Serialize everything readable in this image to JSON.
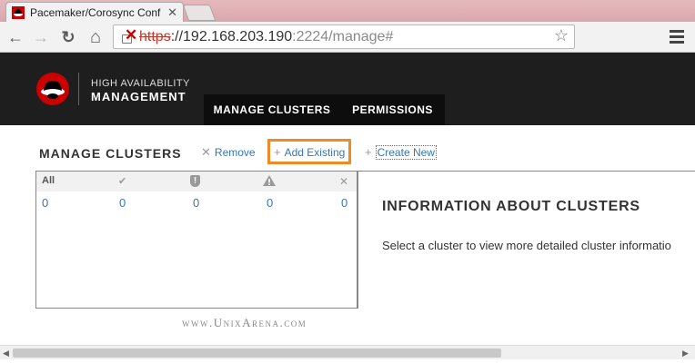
{
  "browser": {
    "tab_title": "Pacemaker/Corosync Conf",
    "tab_close": "✕",
    "url_scheme": "https",
    "url_host": "://192.168.203.190",
    "url_port": ":2224/manage#",
    "nav": {
      "back": "←",
      "forward": "→",
      "reload": "↻",
      "home": "⌂"
    }
  },
  "app": {
    "brand_top": "HIGH AVAILABILITY",
    "brand_main": "MANAGEMENT",
    "nav_tabs": [
      {
        "label": "MANAGE CLUSTERS"
      },
      {
        "label": "PERMISSIONS"
      }
    ]
  },
  "manage": {
    "title": "MANAGE CLUSTERS",
    "actions": {
      "remove": {
        "glyph": "✕",
        "label": "Remove"
      },
      "add_existing": {
        "glyph": "+",
        "label": "Add Existing"
      },
      "create_new": {
        "glyph": "+",
        "label": "Create New"
      }
    },
    "list": {
      "columns": [
        {
          "label": "All",
          "icon": "all-label"
        },
        {
          "label": "✔",
          "icon": "check-icon"
        },
        {
          "label": "!",
          "icon": "shield-alert-icon"
        },
        {
          "label": "!",
          "icon": "warning-icon"
        },
        {
          "label": "✕",
          "icon": "x-icon"
        }
      ],
      "counts": [
        "0",
        "0",
        "0",
        "0",
        "0"
      ]
    }
  },
  "info": {
    "title": "INFORMATION ABOUT CLUSTERS",
    "text": "Select a cluster to view more detailed cluster informatio"
  },
  "watermark": "www.UnixArena.com",
  "colors": {
    "accent": "#3576b8",
    "highlight": "#f08a24",
    "header_bg": "#1e1e1e"
  }
}
